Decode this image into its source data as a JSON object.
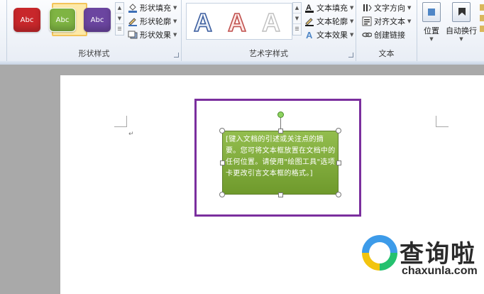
{
  "ribbon": {
    "shape_styles": {
      "group_label": "形状样式",
      "style_buttons": [
        {
          "label": "Abc",
          "color": "#c8272b"
        },
        {
          "label": "Abc",
          "color": "#7fb443"
        },
        {
          "label": "Abc",
          "color": "#6b45a0"
        }
      ],
      "commands": [
        {
          "label": "形状填充",
          "icon": "paint-bucket-icon"
        },
        {
          "label": "形状轮廓",
          "icon": "pen-outline-icon"
        },
        {
          "label": "形状效果",
          "icon": "shape-effects-icon"
        }
      ]
    },
    "wordart_styles": {
      "group_label": "艺术字样式",
      "letters": [
        {
          "label": "A",
          "outline": "#3d5fa0"
        },
        {
          "label": "A",
          "outline": "#c0504d"
        },
        {
          "label": "A",
          "outline": "#bfbfbf"
        }
      ],
      "commands": [
        {
          "label": "文本填充",
          "icon": "text-fill-icon"
        },
        {
          "label": "文本轮廓",
          "icon": "text-outline-icon"
        },
        {
          "label": "文本效果",
          "icon": "text-effects-icon"
        }
      ]
    },
    "text": {
      "group_label": "文本",
      "commands": [
        {
          "label": "文字方向",
          "icon": "text-direction-icon"
        },
        {
          "label": "对齐文本",
          "icon": "align-text-icon"
        },
        {
          "label": "创建链接",
          "icon": "create-link-icon"
        }
      ]
    },
    "arrange": {
      "position_label": "位置",
      "wrap_label": "自动换行"
    }
  },
  "document": {
    "quote_text": "[键入文档的引述或关注点的摘要。您可将文本框放置在文档中的任何位置。请使用\"绘图工具\"选项卡更改引言文本框的格式。]",
    "frame_color": "#7b2f9e",
    "box_color": "#7fb443"
  },
  "watermark": {
    "title": "查询啦",
    "url": "chaxunla.com"
  }
}
